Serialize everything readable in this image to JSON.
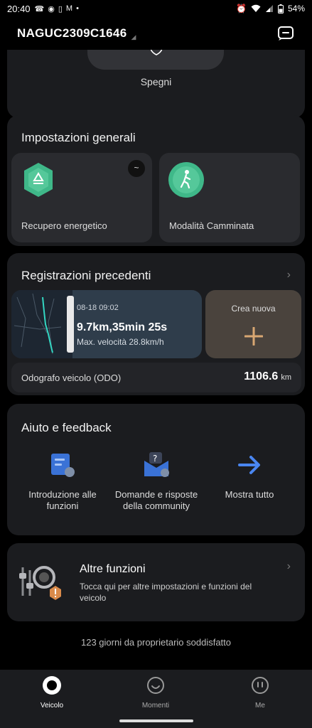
{
  "status_bar": {
    "time": "20:40",
    "battery": "54%",
    "left_icons": [
      "whatsapp-icon",
      "camera-icon",
      "phone-plus-icon",
      "gmail-icon",
      "dot-icon"
    ],
    "right_icons": [
      "alarm-icon",
      "wifi-icon",
      "signal-icon",
      "battery-icon"
    ]
  },
  "header": {
    "device_name": "NAGUC2309C1646"
  },
  "power": {
    "label": "Spegni"
  },
  "general_settings": {
    "title": "Impostazioni generali",
    "tiles": [
      {
        "label": "Recupero energetico",
        "icon": "recycle-icon"
      },
      {
        "label": "Modalità Camminata",
        "icon": "walking-icon"
      }
    ],
    "wave_symbol": "~"
  },
  "records": {
    "title": "Registrazioni precedenti",
    "trip": {
      "date": "08-18 09:02",
      "summary": "9.7km,35min 25s",
      "max_speed": "Max. velocità 28.8km/h"
    },
    "create_label": "Crea nuova",
    "odo_label": "Odografo veicolo (ODO)",
    "odo_value": "1106.6",
    "odo_unit": "km"
  },
  "help": {
    "title": "Aiuto e feedback",
    "items": [
      {
        "label": "Introduzione alle funzioni",
        "icon": "guide-card-icon"
      },
      {
        "label": "Domande e risposte della community",
        "icon": "community-qa-icon"
      },
      {
        "label": "Mostra tutto",
        "icon": "arrow-right-icon"
      }
    ]
  },
  "more": {
    "title": "Altre funzioni",
    "description": "Tocca qui per altre impostazioni e funzioni del veicolo"
  },
  "owner_text": "123 giorni da proprietario soddisfatto",
  "nav": {
    "items": [
      {
        "label": "Veicolo",
        "active": true
      },
      {
        "label": "Momenti",
        "active": false
      },
      {
        "label": "Me",
        "active": false
      }
    ]
  },
  "colors": {
    "background": "#000000",
    "card": "#1b1c1f",
    "tile": "#2a2b2f",
    "accent_green": "#3fb889",
    "trip_card": "#2f3d4b",
    "create_card": "#4a433d",
    "plus": "#d8a772",
    "link_blue": "#4a86f0",
    "warning_orange": "#d98a4a"
  }
}
